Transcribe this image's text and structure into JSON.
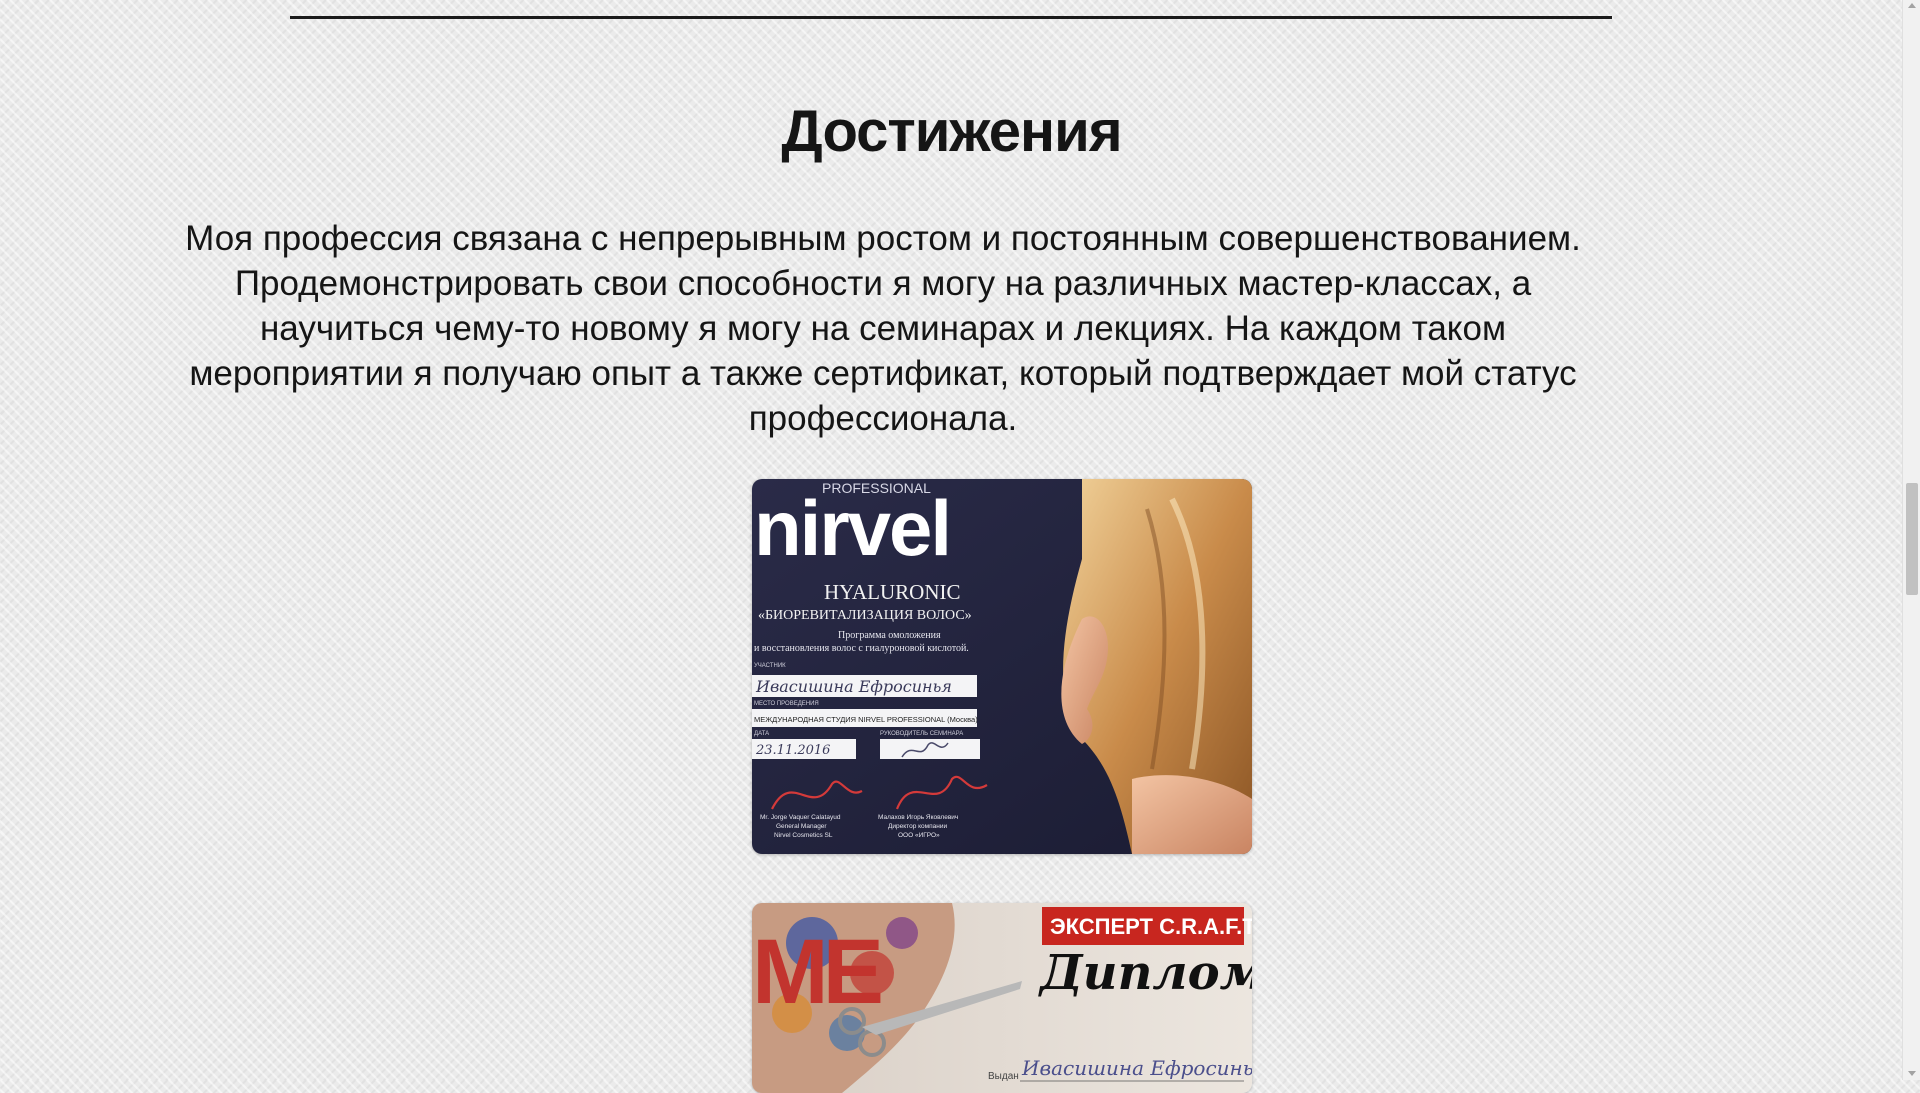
{
  "section": {
    "title": "Достижения",
    "intro": "Моя профессия связана с непрерывным ростом и постоянным совершенствованием. Продемонстрировать свои способности я могу на различных мастер-классах, а научиться чему-то новому я могу на семинарах и лекциях. На каждом таком мероприятии я получаю опыт а также сертификат, который подтверждает мой статус профессионала."
  },
  "certificate_1": {
    "brand_small": "PROFESSIONAL",
    "brand": "nirvel",
    "program": "HYALURONIC",
    "subtitle": "«БИОРЕВИТАЛИЗАЦИЯ ВОЛОС»",
    "line1": "Программа омоложения",
    "line2": "и восстановления волос с гиалуроновой кислотой.",
    "participant_label": "УЧАСТНИК",
    "participant": "Ивасишина Ефросинья",
    "place_label": "МЕСТО ПРОВЕДЕНИЯ",
    "place": "МЕЖДУНАРОДНАЯ СТУДИЯ NIRVEL PROFESSIONAL (Москва)",
    "date_label": "ДАТА",
    "date": "23.11.2016",
    "leader_label": "РУКОВОДИТЕЛЬ СЕМИНАРА",
    "signer1_name": "Mr. Jorge Vaquer Calatayud",
    "signer1_role": "General Manager",
    "signer1_org": "Nirvel Cosmetics SL",
    "signer2_name": "Малахов Игорь Яковлевич",
    "signer2_role": "Директор компании",
    "signer2_org": "ООО «ИГРО»"
  },
  "certificate_2": {
    "badge": "ЭКСПЕРТ C.R.A.F.T.",
    "title": "Диплом",
    "logo": "ME",
    "issued_label": "Выдан",
    "issued_to": "Ивасишина Ефросинья"
  },
  "colors": {
    "cert1_background": "#23243f",
    "cert2_background": "#e9e3dc",
    "badge_red": "#c8261f"
  }
}
